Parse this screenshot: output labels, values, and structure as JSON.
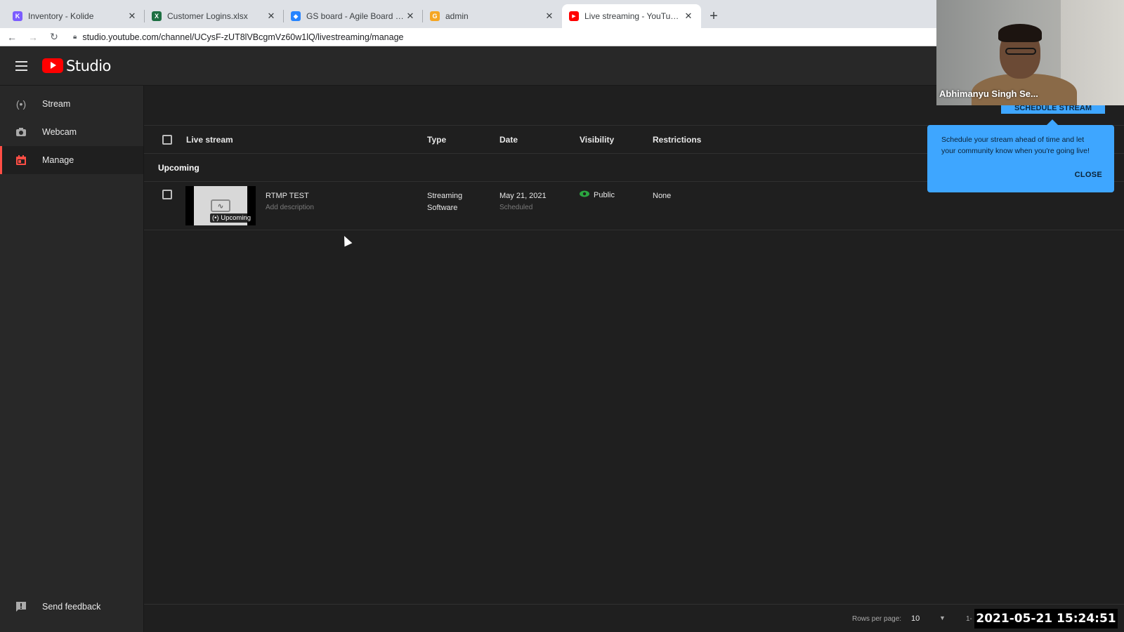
{
  "browser": {
    "tabs": [
      {
        "title": "Inventory - Kolide",
        "icon": "kolide-icon",
        "color": "#7b5cff",
        "glyph": "K"
      },
      {
        "title": "Customer Logins.xlsx",
        "icon": "excel-icon",
        "color": "#1d6f42",
        "glyph": "X"
      },
      {
        "title": "GS board - Agile Board - Jira",
        "icon": "jira-icon",
        "color": "#2684ff",
        "glyph": "◆"
      },
      {
        "title": "admin",
        "icon": "admin-icon",
        "color": "#f5a623",
        "glyph": "G"
      },
      {
        "title": "Live streaming - YouTube Stud",
        "icon": "youtube-icon",
        "color": "#ff0000",
        "glyph": "▶"
      }
    ],
    "url": "studio.youtube.com/channel/UCysF-zUT8lVBcgmVz60w1lQ/livestreaming/manage"
  },
  "header": {
    "logo_text": "Studio"
  },
  "sidebar": {
    "items": [
      {
        "label": "Stream",
        "icon": "broadcast-icon"
      },
      {
        "label": "Webcam",
        "icon": "camera-icon"
      },
      {
        "label": "Manage",
        "icon": "calendar-icon"
      }
    ],
    "feedback_label": "Send feedback"
  },
  "table": {
    "columns": {
      "live_stream": "Live stream",
      "type": "Type",
      "date": "Date",
      "visibility": "Visibility",
      "restrictions": "Restrictions"
    },
    "section": "Upcoming",
    "rows": [
      {
        "title": "RTMP TEST",
        "description_placeholder": "Add description",
        "badge": "(•) Upcoming",
        "type_line1": "Streaming",
        "type_line2": "Software",
        "date": "May 21, 2021",
        "date_status": "Scheduled",
        "visibility": "Public",
        "restrictions": "None"
      }
    ]
  },
  "footer": {
    "rows_per_page_label": "Rows per page:",
    "rows_per_page_value": "10",
    "range_partial": "1-"
  },
  "schedule_button": "SCHEDULE STREAM",
  "tooltip": {
    "text": "Schedule your stream ahead of time and let your community know when you're going live!",
    "close_label": "CLOSE"
  },
  "webcam_overlay": {
    "name": "Abhimanyu Singh Se..."
  },
  "timestamp": "2021-05-21 15:24:51"
}
